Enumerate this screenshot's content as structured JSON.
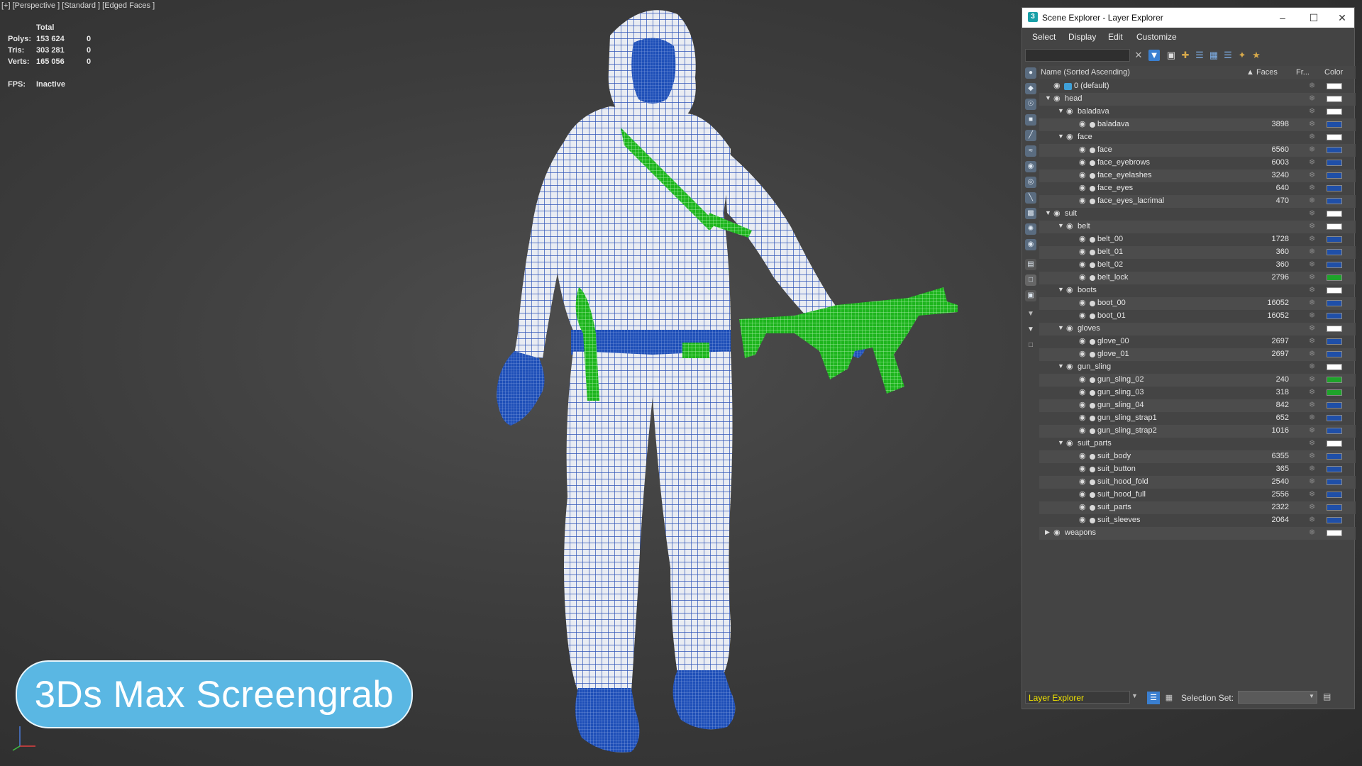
{
  "viewport": {
    "label": "[+] [Perspective ] [Standard ] [Edged Faces ]",
    "stats": {
      "header": "Total",
      "polys_label": "Polys:",
      "polys": "153 624",
      "polys_sel": "0",
      "tris_label": "Tris:",
      "tris": "303 281",
      "tris_sel": "0",
      "verts_label": "Verts:",
      "verts": "165 056",
      "verts_sel": "0",
      "fps_label": "FPS:",
      "fps": "Inactive"
    },
    "banner": "3Ds Max Screengrab"
  },
  "window": {
    "title": "Scene Explorer - Layer Explorer",
    "menu": [
      "Select",
      "Display",
      "Edit",
      "Customize"
    ],
    "columns": {
      "name": "Name (Sorted Ascending)",
      "faces": "▲ Faces",
      "frozen": "Fr...",
      "color": "Color"
    },
    "rows": [
      {
        "depth": 0,
        "type": "layer",
        "expand": "",
        "name": "0 (default)",
        "faces": "",
        "color": "#ffffff"
      },
      {
        "depth": 0,
        "type": "group",
        "expand": "▼",
        "name": "head",
        "faces": "",
        "color": "#ffffff"
      },
      {
        "depth": 1,
        "type": "group",
        "expand": "▼",
        "name": "baladava",
        "faces": "",
        "color": "#ffffff"
      },
      {
        "depth": 2,
        "type": "obj",
        "expand": "",
        "name": "baladava",
        "faces": "3898",
        "color": "#1f4fa8"
      },
      {
        "depth": 1,
        "type": "group",
        "expand": "▼",
        "name": "face",
        "faces": "",
        "color": "#ffffff"
      },
      {
        "depth": 2,
        "type": "obj",
        "expand": "",
        "name": "face",
        "faces": "6560",
        "color": "#1f4fa8"
      },
      {
        "depth": 2,
        "type": "obj",
        "expand": "",
        "name": "face_eyebrows",
        "faces": "6003",
        "color": "#1f4fa8"
      },
      {
        "depth": 2,
        "type": "obj",
        "expand": "",
        "name": "face_eyelashes",
        "faces": "3240",
        "color": "#1f4fa8"
      },
      {
        "depth": 2,
        "type": "obj",
        "expand": "",
        "name": "face_eyes",
        "faces": "640",
        "color": "#1f4fa8"
      },
      {
        "depth": 2,
        "type": "obj",
        "expand": "",
        "name": "face_eyes_lacrimal",
        "faces": "470",
        "color": "#1f4fa8"
      },
      {
        "depth": 0,
        "type": "group",
        "expand": "▼",
        "name": "suit",
        "faces": "",
        "color": "#ffffff"
      },
      {
        "depth": 1,
        "type": "group",
        "expand": "▼",
        "name": "belt",
        "faces": "",
        "color": "#ffffff"
      },
      {
        "depth": 2,
        "type": "obj",
        "expand": "",
        "name": "belt_00",
        "faces": "1728",
        "color": "#1f4fa8"
      },
      {
        "depth": 2,
        "type": "obj",
        "expand": "",
        "name": "belt_01",
        "faces": "360",
        "color": "#1f4fa8"
      },
      {
        "depth": 2,
        "type": "obj",
        "expand": "",
        "name": "belt_02",
        "faces": "360",
        "color": "#1f4fa8"
      },
      {
        "depth": 2,
        "type": "obj",
        "expand": "",
        "name": "belt_lock",
        "faces": "2796",
        "color": "#1ea32a"
      },
      {
        "depth": 1,
        "type": "group",
        "expand": "▼",
        "name": "boots",
        "faces": "",
        "color": "#ffffff"
      },
      {
        "depth": 2,
        "type": "obj",
        "expand": "",
        "name": "boot_00",
        "faces": "16052",
        "color": "#1f4fa8"
      },
      {
        "depth": 2,
        "type": "obj",
        "expand": "",
        "name": "boot_01",
        "faces": "16052",
        "color": "#1f4fa8"
      },
      {
        "depth": 1,
        "type": "group",
        "expand": "▼",
        "name": "gloves",
        "faces": "",
        "color": "#ffffff"
      },
      {
        "depth": 2,
        "type": "obj",
        "expand": "",
        "name": "glove_00",
        "faces": "2697",
        "color": "#1f4fa8"
      },
      {
        "depth": 2,
        "type": "obj",
        "expand": "",
        "name": "glove_01",
        "faces": "2697",
        "color": "#1f4fa8"
      },
      {
        "depth": 1,
        "type": "group",
        "expand": "▼",
        "name": "gun_sling",
        "faces": "",
        "color": "#ffffff"
      },
      {
        "depth": 2,
        "type": "obj",
        "expand": "",
        "name": "gun_sling_02",
        "faces": "240",
        "color": "#1ea32a"
      },
      {
        "depth": 2,
        "type": "obj",
        "expand": "",
        "name": "gun_sling_03",
        "faces": "318",
        "color": "#1ea32a"
      },
      {
        "depth": 2,
        "type": "obj",
        "expand": "",
        "name": "gun_sling_04",
        "faces": "842",
        "color": "#1f4fa8"
      },
      {
        "depth": 2,
        "type": "obj",
        "expand": "",
        "name": "gun_sling_strap1",
        "faces": "652",
        "color": "#1f4fa8"
      },
      {
        "depth": 2,
        "type": "obj",
        "expand": "",
        "name": "gun_sling_strap2",
        "faces": "1016",
        "color": "#1f4fa8"
      },
      {
        "depth": 1,
        "type": "group",
        "expand": "▼",
        "name": "suit_parts",
        "faces": "",
        "color": "#ffffff"
      },
      {
        "depth": 2,
        "type": "obj",
        "expand": "",
        "name": "suit_body",
        "faces": "6355",
        "color": "#1f4fa8"
      },
      {
        "depth": 2,
        "type": "obj",
        "expand": "",
        "name": "suit_button",
        "faces": "365",
        "color": "#1f4fa8"
      },
      {
        "depth": 2,
        "type": "obj",
        "expand": "",
        "name": "suit_hood_fold",
        "faces": "2540",
        "color": "#1f4fa8"
      },
      {
        "depth": 2,
        "type": "obj",
        "expand": "",
        "name": "suit_hood_full",
        "faces": "2556",
        "color": "#1f4fa8"
      },
      {
        "depth": 2,
        "type": "obj",
        "expand": "",
        "name": "suit_parts",
        "faces": "2322",
        "color": "#1f4fa8"
      },
      {
        "depth": 2,
        "type": "obj",
        "expand": "",
        "name": "suit_sleeves",
        "faces": "2064",
        "color": "#1f4fa8"
      },
      {
        "depth": 0,
        "type": "group",
        "expand": "▶",
        "name": "weapons",
        "faces": "",
        "color": "#ffffff"
      }
    ],
    "bottom": {
      "explorer_dropdown": "Layer Explorer",
      "selection_set_label": "Selection Set:"
    }
  }
}
